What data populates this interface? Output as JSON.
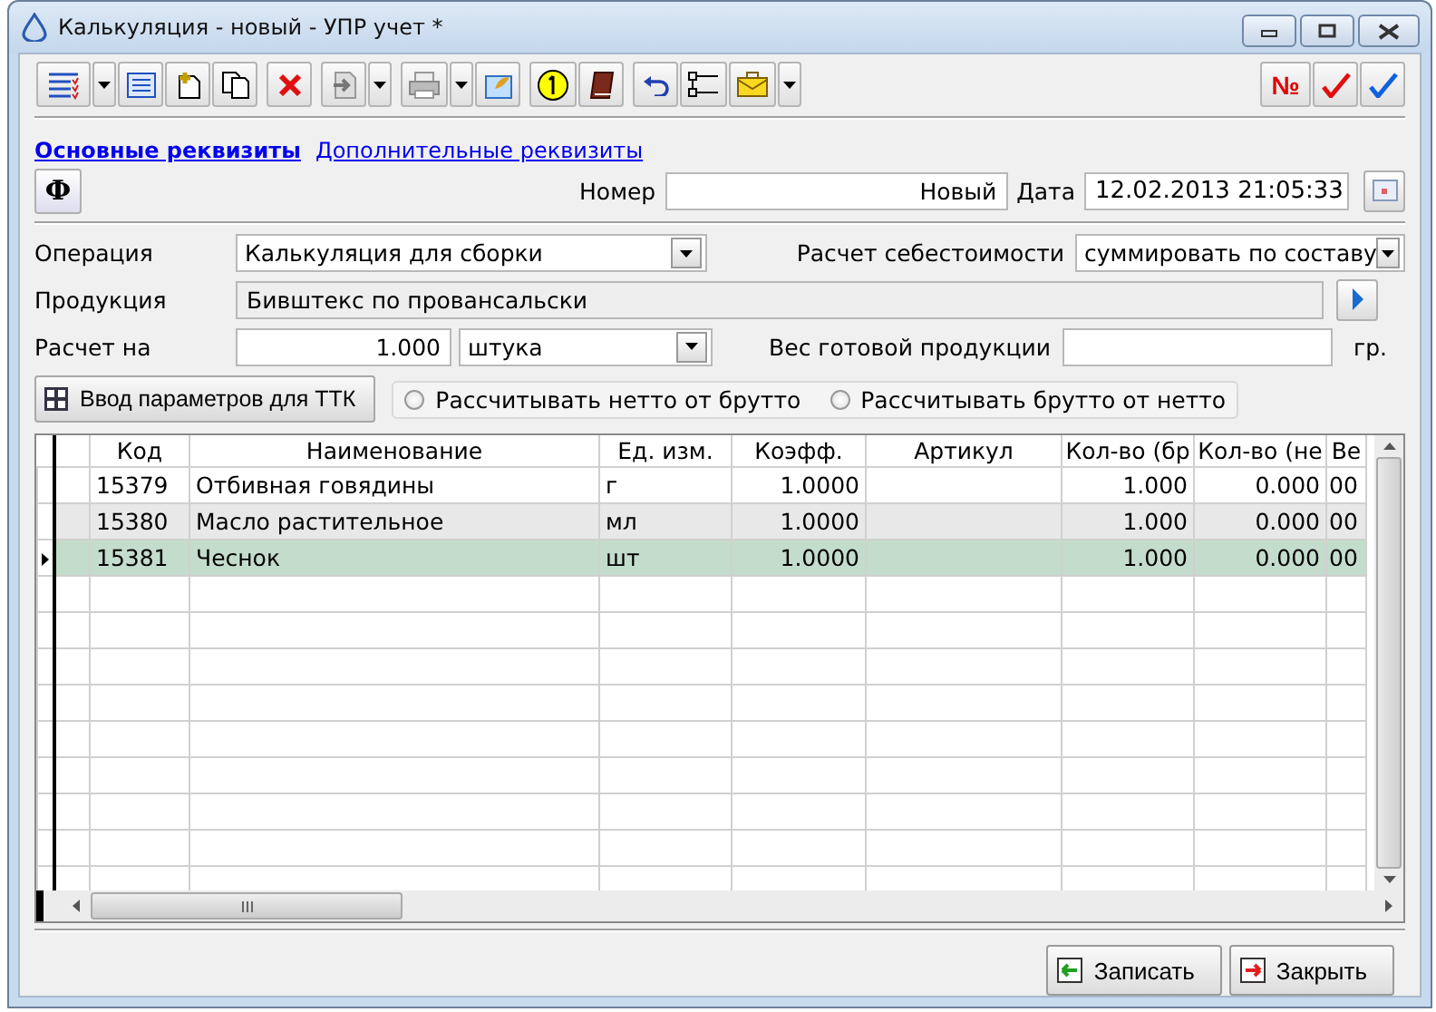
{
  "window": {
    "title": "Калькуляция - новый - УПР учет *"
  },
  "toolbar": {
    "number_button": "№"
  },
  "tabs": [
    {
      "label": "Основные реквизиты",
      "selected": true
    },
    {
      "label": "Дополнительные реквизиты",
      "selected": false
    }
  ],
  "header": {
    "formula_button": "Ф",
    "number_label": "Номер",
    "number_value": "Новый",
    "date_label": "Дата",
    "date_value": "12.02.2013 21:05:33"
  },
  "form": {
    "operation_label": "Операция",
    "operation_value": "Калькуляция для сборки",
    "cost_label": "Расчет себестоимости",
    "cost_value": "суммировать по составу",
    "product_label": "Продукция",
    "product_value": "Бивштекс по провансальски",
    "calc_label": "Расчет на",
    "calc_qty": "1.000",
    "calc_unit": "штука",
    "weight_label": "Вес готовой продукции",
    "weight_unit": "гр."
  },
  "ttk_button": "Ввод параметров для ТТК",
  "radios": [
    {
      "label": "Рассчитывать нетто от брутто",
      "selected": false
    },
    {
      "label": "Рассчитывать брутто от нетто",
      "selected": false
    }
  ],
  "table": {
    "columns": [
      "Код",
      "Наименование",
      "Ед. изм.",
      "Коэфф.",
      "Артикул",
      "Кол-во (бр",
      "Кол-во (не",
      "Ве"
    ],
    "rows": [
      {
        "cells": [
          "15379",
          "Отбивная говядины",
          "г",
          "1.0000",
          "",
          "1.000",
          "0.000",
          "00"
        ],
        "selected": false
      },
      {
        "cells": [
          "15380",
          "Масло растительное",
          "мл",
          "1.0000",
          "",
          "1.000",
          "0.000",
          "00"
        ],
        "selected": false
      },
      {
        "cells": [
          "15381",
          "Чеснок",
          "шт",
          "1.0000",
          "",
          "1.000",
          "0.000",
          "00"
        ],
        "selected": true
      }
    ]
  },
  "footer_buttons": [
    "Записать",
    "Закрыть"
  ]
}
